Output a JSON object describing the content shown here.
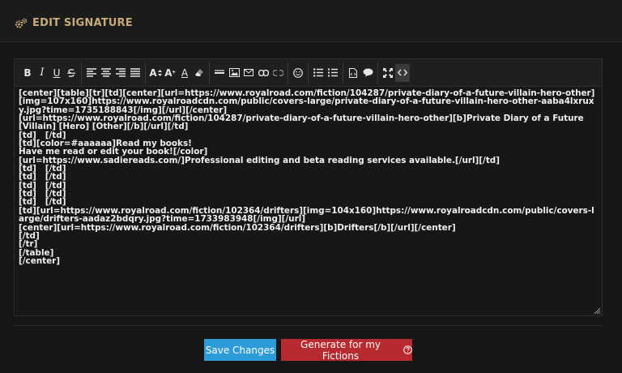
{
  "header": {
    "title": "EDIT SIGNATURE",
    "icon": "gears-icon",
    "accent": "#c8aa7a"
  },
  "toolbar": {
    "groups": [
      [
        "bold",
        "italic",
        "underline",
        "strikethrough"
      ],
      [
        "align-left",
        "align-center",
        "align-right",
        "align-justify"
      ],
      [
        "font-size",
        "superscript",
        "font-color",
        "eraser"
      ],
      [
        "horizontal-rule",
        "image",
        "email",
        "link",
        "unlink"
      ],
      [
        "emoticon"
      ],
      [
        "bullet-list",
        "numbered-list"
      ],
      [
        "code",
        "quote"
      ],
      [
        "maximize",
        "source"
      ]
    ],
    "labels": {
      "bold": "B",
      "italic": "I",
      "underline": "U",
      "font_size": "A",
      "superscript": "A",
      "font_color": "A"
    }
  },
  "editor": {
    "lines": [
      "[center][table][tr][td][center][url=https://www.royalroad.com/fiction/104287/private-diary-of-a-future-villain-hero-other][img=107x160]https://www.royalroadcdn.com/public/covers-large/private-diary-of-a-future-villain-hero-other-aaba4lxruxy.jpg?time=1735188843[/img][/url][/center]",
      "[url=https://www.royalroad.com/fiction/104287/private-diary-of-a-future-villain-hero-other][b]Private Diary of a Future [Villain] [Hero] [Other][/b][/url][/td]",
      "[td]   [/td]",
      "[td][color=#aaaaaa]Read my books!",
      "Have me read or edit your book![/color]",
      "[url=https://www.sadiereads.com/]Professional editing and beta reading services available.[/url][/td]",
      "[td]   [/td]",
      "[td]   [/td]",
      "[td]   [/td]",
      "[td]   [/td]",
      "[td]   [/td]",
      "[td][url=https://www.royalroad.com/fiction/102364/drifters][img=104x160]https://www.royalroadcdn.com/public/covers-large/drifters-aadaz2bdqry.jpg?time=1733983948[/img][/url]",
      "[center][url=https://www.royalroad.com/fiction/102364/drifters][b]Drifters[/b][/url][/center]",
      "[/td]",
      "[/tr]",
      "[/table]",
      "[/center]"
    ]
  },
  "buttons": {
    "save": "Save Changes",
    "generate": "Generate for my Fictions",
    "generate_icon": "question-circle-icon",
    "save_color": "#2e9bd9",
    "generate_color": "#b72a2f"
  }
}
